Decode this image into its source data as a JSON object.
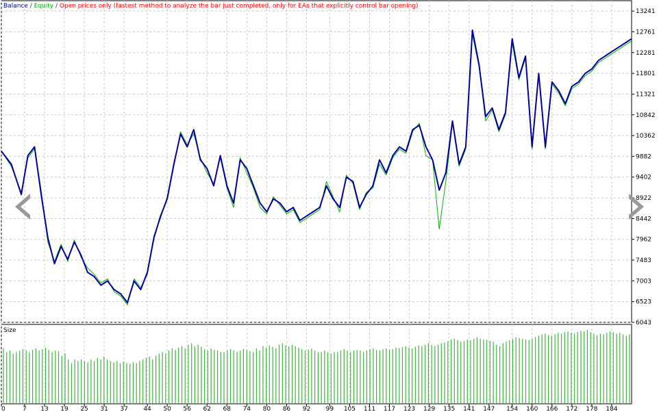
{
  "header": {
    "balance_label": "Balance",
    "sep1": " / ",
    "equity_label": "Equity",
    "sep2": " / ",
    "mode_text": "Open prices only (fastest method to analyze the bar just completed, only for EAs that explicitly control bar opening)"
  },
  "sub_panel": {
    "title": "Size"
  },
  "colors": {
    "balance": "#0000a0",
    "equity": "#00b000",
    "mode_text": "#ff0000",
    "grid": "#c8c8c8",
    "frame": "#000000",
    "size_bar": "#3cb43c",
    "nav_arrow": "#999999"
  },
  "nav": {
    "left": "arrow-left-icon",
    "right": "arrow-right-icon"
  },
  "chart_data": [
    {
      "type": "line",
      "title": "",
      "xlabel": "",
      "ylabel": "",
      "xlim": [
        0,
        190
      ],
      "ylim": [
        6043,
        13481
      ],
      "grid": true,
      "y_ticks": [
        6043,
        6523,
        7003,
        7483,
        7962,
        8442,
        8922,
        9402,
        9882,
        10362,
        10842,
        11321,
        11801,
        12281,
        12761,
        13241
      ],
      "x_ticks": [
        0,
        7,
        13,
        19,
        25,
        31,
        37,
        44,
        50,
        56,
        62,
        68,
        74,
        80,
        86,
        92,
        99,
        105,
        111,
        117,
        123,
        129,
        135,
        141,
        147,
        154,
        160,
        166,
        172,
        178,
        184
      ],
      "series": [
        {
          "name": "Balance",
          "x": [
            0,
            3,
            6,
            8,
            10,
            12,
            14,
            16,
            18,
            20,
            22,
            24,
            26,
            28,
            30,
            32,
            34,
            36,
            38,
            40,
            42,
            44,
            46,
            48,
            50,
            52,
            54,
            56,
            58,
            60,
            62,
            64,
            66,
            68,
            70,
            72,
            74,
            76,
            78,
            80,
            82,
            84,
            86,
            88,
            90,
            92,
            94,
            96,
            98,
            100,
            102,
            104,
            106,
            108,
            110,
            112,
            114,
            116,
            118,
            120,
            122,
            124,
            126,
            128,
            130,
            132,
            134,
            136,
            138,
            140,
            142,
            144,
            146,
            148,
            150,
            152,
            154,
            156,
            158,
            160,
            162,
            164,
            166,
            168,
            170,
            172,
            174,
            176,
            178,
            180,
            182,
            184,
            186,
            188,
            190
          ],
          "y": [
            10000,
            9700,
            9000,
            9900,
            10100,
            9000,
            8000,
            7400,
            7800,
            7500,
            7900,
            7600,
            7200,
            7100,
            6900,
            7000,
            6800,
            6700,
            6500,
            7000,
            6800,
            7200,
            8000,
            8500,
            8900,
            9700,
            10400,
            10100,
            10500,
            9800,
            9600,
            9200,
            9900,
            9200,
            8800,
            9800,
            9600,
            9200,
            8800,
            8600,
            8900,
            8800,
            8600,
            8700,
            8400,
            8500,
            8600,
            8700,
            9200,
            8900,
            8700,
            9400,
            9300,
            8700,
            9000,
            9200,
            9800,
            9500,
            9900,
            10100,
            10000,
            10500,
            10600,
            10100,
            9800,
            9100,
            9500,
            10700,
            9700,
            10100,
            12800,
            12000,
            10800,
            11000,
            10500,
            10900,
            12600,
            11700,
            12200,
            10100,
            11800,
            10100,
            11600,
            11400,
            11100,
            11500,
            11600,
            11800,
            11900,
            12100,
            12200,
            12300,
            12400,
            12500,
            12600
          ]
        },
        {
          "name": "Equity",
          "x": [
            0,
            3,
            6,
            8,
            10,
            12,
            14,
            16,
            18,
            20,
            22,
            24,
            26,
            28,
            30,
            32,
            34,
            36,
            38,
            40,
            42,
            44,
            46,
            48,
            50,
            52,
            54,
            56,
            58,
            60,
            62,
            64,
            66,
            68,
            70,
            72,
            74,
            76,
            78,
            80,
            82,
            84,
            86,
            88,
            90,
            92,
            94,
            96,
            98,
            100,
            102,
            104,
            106,
            108,
            110,
            112,
            114,
            116,
            118,
            120,
            122,
            124,
            126,
            128,
            130,
            132,
            134,
            136,
            138,
            140,
            142,
            144,
            146,
            148,
            150,
            152,
            154,
            156,
            158,
            160,
            162,
            164,
            166,
            168,
            170,
            172,
            174,
            176,
            178,
            180,
            182,
            184,
            186,
            188,
            190
          ],
          "y": [
            10000,
            9650,
            9050,
            9850,
            10050,
            9100,
            7900,
            7450,
            7850,
            7450,
            7950,
            7550,
            7300,
            7150,
            6950,
            7050,
            6750,
            6650,
            6450,
            7050,
            6850,
            7150,
            8050,
            8450,
            8950,
            9650,
            10450,
            10150,
            10400,
            9850,
            9500,
            9250,
            9850,
            9150,
            8700,
            9850,
            9500,
            9150,
            8700,
            8550,
            8950,
            8750,
            8550,
            8650,
            8350,
            8450,
            8550,
            8650,
            9300,
            8950,
            8600,
            9450,
            9250,
            8650,
            9050,
            9150,
            9700,
            9450,
            9850,
            10050,
            9950,
            10450,
            10650,
            9900,
            9800,
            8200,
            9300,
            10650,
            9650,
            10050,
            12700,
            11950,
            10700,
            10950,
            10450,
            10850,
            12500,
            11650,
            12150,
            10050,
            11750,
            10050,
            11550,
            11350,
            11050,
            11450,
            11550,
            11750,
            11850,
            12050,
            12150,
            12250,
            12350,
            12450,
            12550
          ]
        }
      ]
    },
    {
      "type": "bar",
      "title": "Size",
      "xlim": [
        0,
        190
      ],
      "ylim": [
        0,
        1
      ],
      "values": [
        0.75,
        0.7,
        0.72,
        0.68,
        0.7,
        0.72,
        0.74,
        0.72,
        0.7,
        0.73,
        0.75,
        0.72,
        0.74,
        0.76,
        0.73,
        0.7,
        0.72,
        0.71,
        0.65,
        0.68,
        0.6,
        0.55,
        0.6,
        0.58,
        0.6,
        0.58,
        0.56,
        0.6,
        0.58,
        0.62,
        0.6,
        0.64,
        0.6,
        0.58,
        0.56,
        0.58,
        0.55,
        0.57,
        0.55,
        0.54,
        0.56,
        0.55,
        0.58,
        0.6,
        0.62,
        0.64,
        0.6,
        0.65,
        0.68,
        0.7,
        0.68,
        0.72,
        0.75,
        0.73,
        0.76,
        0.78,
        0.75,
        0.8,
        0.82,
        0.78,
        0.8,
        0.77,
        0.74,
        0.72,
        0.75,
        0.73,
        0.72,
        0.7,
        0.7,
        0.72,
        0.74,
        0.72,
        0.7,
        0.72,
        0.74,
        0.73,
        0.71,
        0.7,
        0.75,
        0.72,
        0.78,
        0.76,
        0.79,
        0.77,
        0.75,
        0.8,
        0.82,
        0.79,
        0.78,
        0.8,
        0.78,
        0.76,
        0.74,
        0.72,
        0.73,
        0.75,
        0.72,
        0.7,
        0.7,
        0.72,
        0.7,
        0.68,
        0.7,
        0.7,
        0.72,
        0.74,
        0.72,
        0.7,
        0.72,
        0.73,
        0.72,
        0.7,
        0.72,
        0.74,
        0.75,
        0.73,
        0.72,
        0.74,
        0.75,
        0.73,
        0.74,
        0.76,
        0.75,
        0.77,
        0.78,
        0.76,
        0.75,
        0.77,
        0.79,
        0.78,
        0.8,
        0.82,
        0.8,
        0.78,
        0.8,
        0.82,
        0.83,
        0.85,
        0.87,
        0.88,
        0.86,
        0.84,
        0.85,
        0.87,
        0.86,
        0.88,
        0.9,
        0.88,
        0.87,
        0.86,
        0.85,
        0.84,
        0.8,
        0.78,
        0.82,
        0.84,
        0.86,
        0.88,
        0.9,
        0.89,
        0.88,
        0.87,
        0.86,
        0.88,
        0.9,
        0.92,
        0.94,
        0.95,
        0.93,
        0.92,
        0.94,
        0.96,
        0.95,
        0.97,
        0.98,
        0.96,
        0.95,
        0.97,
        0.99,
        0.98,
        1.0,
        0.97,
        0.95,
        0.93,
        0.95,
        0.94,
        0.96,
        0.98,
        0.97,
        0.95,
        0.96,
        0.94,
        0.92,
        0.94
      ]
    }
  ]
}
